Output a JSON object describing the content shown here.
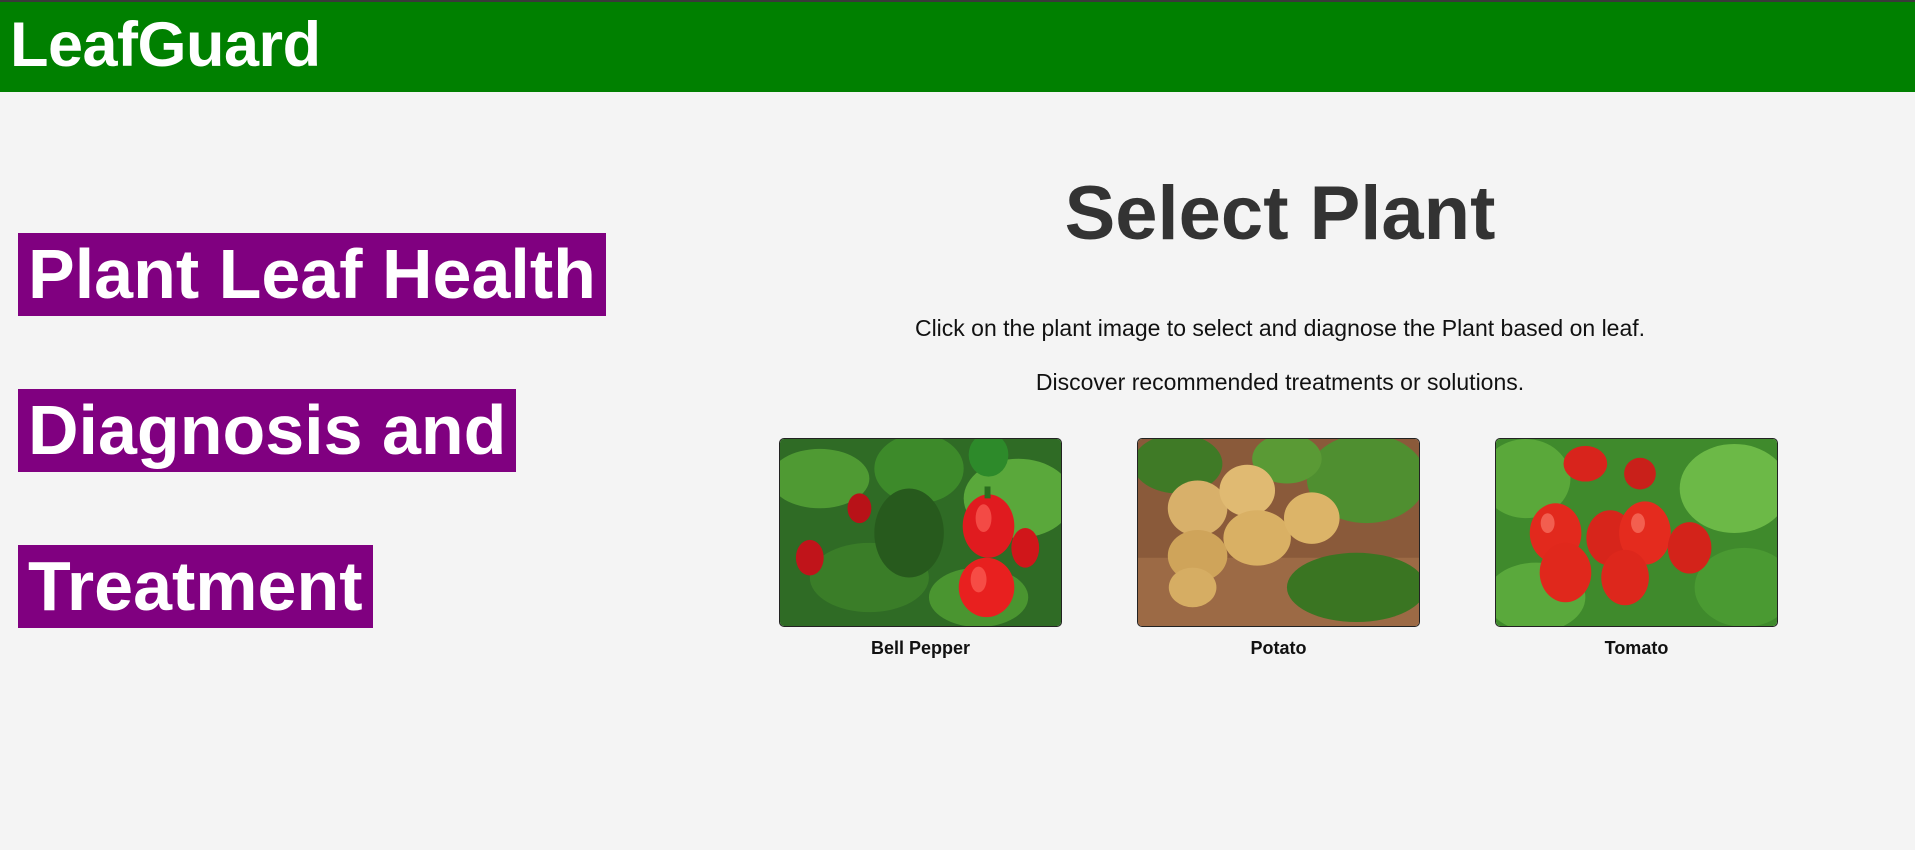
{
  "header": {
    "brand": "LeafGuard"
  },
  "headline": {
    "lines": [
      "Plant Leaf Health",
      "Diagnosis and",
      "Treatment"
    ]
  },
  "main": {
    "title": "Select Plant",
    "instruction": "Click on the plant image to select and diagnose the Plant based on leaf.",
    "tagline": "Discover recommended treatments or solutions.",
    "plants": [
      {
        "label": "Bell Pepper"
      },
      {
        "label": "Potato"
      },
      {
        "label": "Tomato"
      }
    ]
  },
  "colors": {
    "header_bg": "#008000",
    "headline_bg": "#800080",
    "page_bg": "#f4f4f4",
    "title_text": "#333333"
  }
}
